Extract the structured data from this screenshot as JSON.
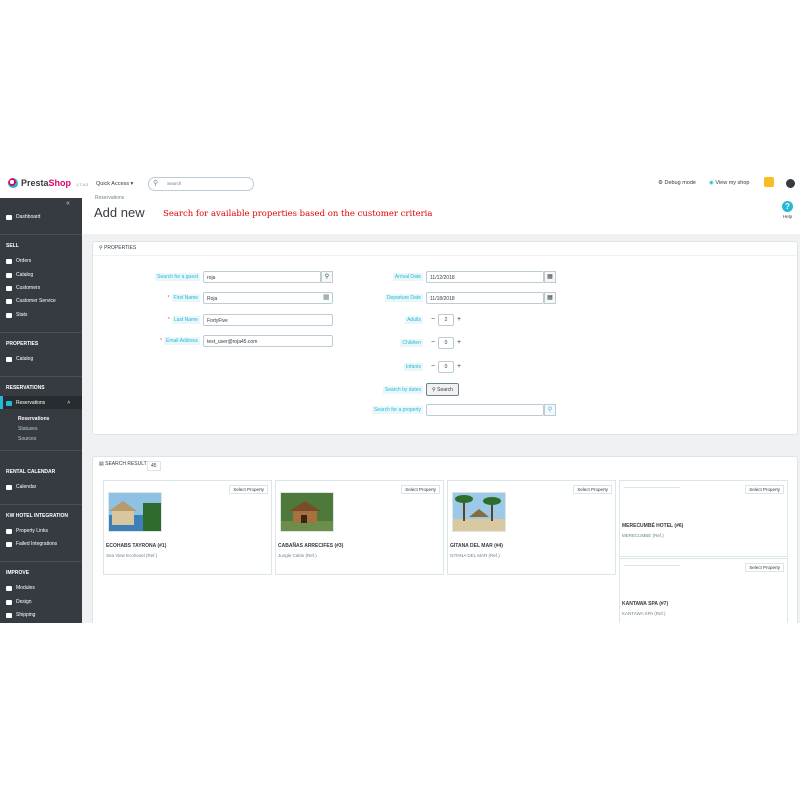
{
  "topbar": {
    "logo_presta": "Presta",
    "logo_shop": "Shop",
    "version": "1.7.4.2",
    "quick_access": "Quick Access ▾",
    "search_placeholder": "Search",
    "debug_mode": "Debug mode",
    "view_my_shop": "View my shop"
  },
  "sidebar": {
    "dashboard": "Dashboard",
    "sell_head": "SELL",
    "orders": "Orders",
    "catalog": "Catalog",
    "customers": "Customers",
    "customer_service": "Customer Service",
    "stats": "Stats",
    "properties_head": "PROPERTIES",
    "prop_catalog": "Catalog",
    "reservations_head": "RESERVATIONS",
    "reservations": "Reservations",
    "sub_reservations": "Reservations",
    "sub_statuses": "Statuses",
    "sub_sources": "Sources",
    "rental_calendar_head": "RENTAL CALENDAR",
    "calendar": "Calendar",
    "kw_head": "KW HOTEL INTEGRATION",
    "property_links": "Property Links",
    "failed_integrations": "Failed Integrations",
    "improve_head": "IMPROVE",
    "modules": "Modules",
    "design": "Design",
    "shipping": "Shipping"
  },
  "header": {
    "breadcrumb": "Reservations",
    "title": "Add new",
    "annotation": "Search for available properties based on the customer criteria",
    "help": "Help"
  },
  "form": {
    "panel_title": "PROPERTIES",
    "search_guest_label": "Search for a guest",
    "search_guest_value": "roja",
    "first_name_label": "First Name",
    "first_name_value": "Roja",
    "last_name_label": "Last Name",
    "last_name_value": "FortyFive",
    "email_label": "Email Address",
    "email_value": "test_user@roja45.com",
    "arrival_label": "Arrival Date",
    "arrival_value": "11/12/2018",
    "departure_label": "Departure Date",
    "departure_value": "11/18/2018",
    "adults_label": "Adults",
    "adults_value": "2",
    "children_label": "Children",
    "children_value": "0",
    "infants_label": "Infants",
    "infants_value": "0",
    "search_by_dates_label": "Search by dates",
    "search_button": "Search",
    "search_property_label": "Search for a property",
    "search_property_value": ""
  },
  "results": {
    "title": "SEARCH RESULTS",
    "count": "45",
    "select_label": "Select Property",
    "cards": [
      {
        "name": "ECOHABS TAYRONA (#1)",
        "sub": "Sea View Ecohosel (Ref.)"
      },
      {
        "name": "CABAÑAS ARRECIFES (#3)",
        "sub": "Jungle Cabin (Ref.)"
      },
      {
        "name": "GITANA DEL MAR (#4)",
        "sub": "GITANA DEL MAR (Ref.)"
      },
      {
        "name": "MERECUMBÉ HOTEL (#6)",
        "sub": "MERECUMBÉ (Ref.)"
      },
      {
        "name": "KANTAWA SPA (#7)",
        "sub": "KANTAWA SPA (Ref.)"
      }
    ]
  },
  "colors": {
    "accent": "#25b9d7",
    "sidebar": "#363a41",
    "brand": "#df0067",
    "annotation": "#e60000"
  }
}
